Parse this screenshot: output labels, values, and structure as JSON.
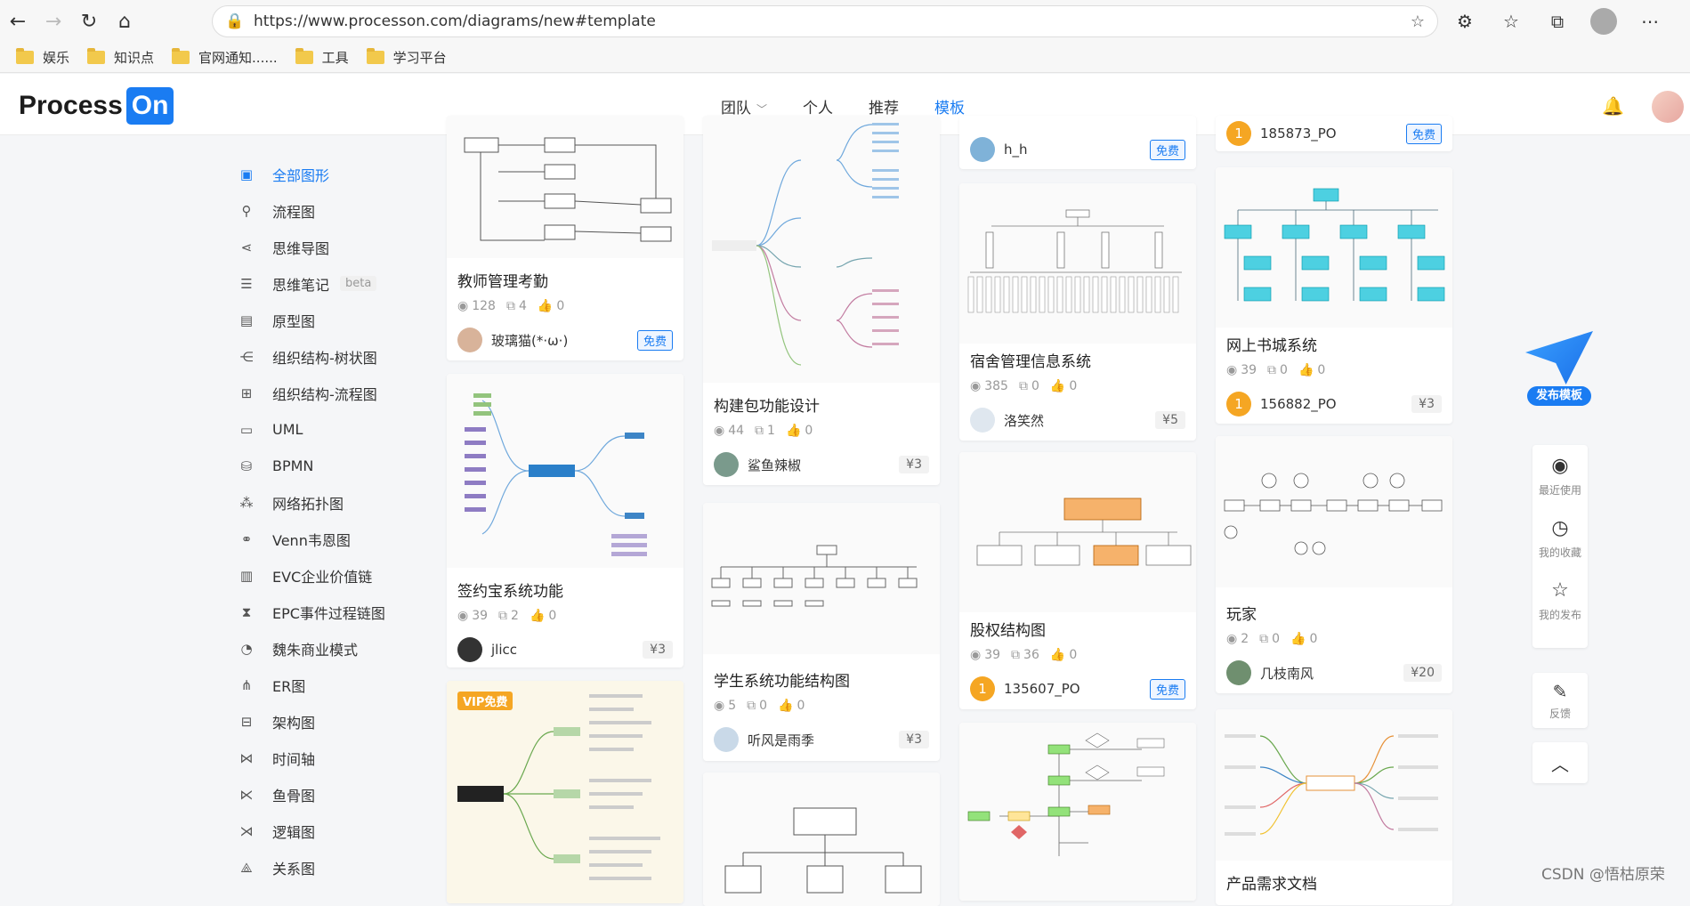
{
  "browser": {
    "url": "https://www.processon.com/diagrams/new#template",
    "bookmarks": [
      "娱乐",
      "知识点",
      "官网通知......",
      "工具",
      "学习平台"
    ]
  },
  "header": {
    "logo_process": "Process",
    "logo_on": "On",
    "nav": {
      "team": "团队",
      "personal": "个人",
      "recommend": "推荐",
      "templates": "模板"
    }
  },
  "sidebar": {
    "items": [
      {
        "label": "全部图形",
        "icon": "grid-icon"
      },
      {
        "label": "流程图",
        "icon": "flowchart-icon"
      },
      {
        "label": "思维导图",
        "icon": "mindmap-icon"
      },
      {
        "label": "思维笔记",
        "icon": "list-icon",
        "badge": "beta"
      },
      {
        "label": "原型图",
        "icon": "prototype-icon"
      },
      {
        "label": "组织结构-树状图",
        "icon": "org-tree-icon"
      },
      {
        "label": "组织结构-流程图",
        "icon": "org-flow-icon"
      },
      {
        "label": "UML",
        "icon": "uml-icon"
      },
      {
        "label": "BPMN",
        "icon": "bpmn-icon"
      },
      {
        "label": "网络拓扑图",
        "icon": "network-icon"
      },
      {
        "label": "Venn韦恩图",
        "icon": "venn-icon"
      },
      {
        "label": "EVC企业价值链",
        "icon": "evc-icon"
      },
      {
        "label": "EPC事件过程链图",
        "icon": "epc-icon"
      },
      {
        "label": "魏朱商业模式",
        "icon": "business-model-icon"
      },
      {
        "label": "ER图",
        "icon": "er-icon"
      },
      {
        "label": "架构图",
        "icon": "architecture-icon"
      },
      {
        "label": "时间轴",
        "icon": "timeline-icon"
      },
      {
        "label": "鱼骨图",
        "icon": "fishbone-icon"
      },
      {
        "label": "逻辑图",
        "icon": "logic-icon"
      },
      {
        "label": "关系图",
        "icon": "relation-icon"
      }
    ]
  },
  "cards": {
    "c1": {
      "title": "教师管理考勤",
      "views": "128",
      "copies": "4",
      "likes": "0",
      "author": "玻璃猫(*·ω·)",
      "tag": "免费"
    },
    "c2": {
      "title": "签约宝系统功能",
      "views": "39",
      "copies": "2",
      "likes": "0",
      "author": "jlicc",
      "tag": "¥3"
    },
    "c3": {
      "vip": "VIP免费"
    },
    "c4": {
      "title": "构建包功能设计",
      "views": "44",
      "copies": "1",
      "likes": "0",
      "author": "鲨鱼辣椒",
      "tag": "¥3"
    },
    "c5": {
      "title": "学生系统功能结构图",
      "views": "5",
      "copies": "0",
      "likes": "0",
      "author": "听风是雨季",
      "tag": "¥3"
    },
    "c6": {
      "author": "h_h",
      "tag": "免费"
    },
    "c7": {
      "title": "宿舍管理信息系统",
      "views": "385",
      "copies": "0",
      "likes": "0",
      "author": "洛笑然",
      "tag": "¥5"
    },
    "c8": {
      "title": "股权结构图",
      "views": "39",
      "copies": "36",
      "likes": "0",
      "author": "135607_PO",
      "tag": "免费"
    },
    "c9": {
      "author": "185873_PO",
      "tag": "免费"
    },
    "c10": {
      "title": "网上书城系统",
      "views": "39",
      "copies": "0",
      "likes": "0",
      "author": "156882_PO",
      "tag": "¥3"
    },
    "c11": {
      "title": "玩家",
      "views": "2",
      "copies": "0",
      "likes": "0",
      "author": "几枝南风",
      "tag": "¥20"
    },
    "c12": {
      "title": "产品需求文档"
    }
  },
  "float": {
    "publish": "发布模板"
  },
  "tools": {
    "recent": "最近使用",
    "favorites": "我的收藏",
    "published": "我的发布",
    "feedback": "反馈"
  },
  "watermark": "CSDN @悟枯原荣",
  "colors": {
    "accent": "#1a7cf2",
    "orange": "#f5a623"
  }
}
